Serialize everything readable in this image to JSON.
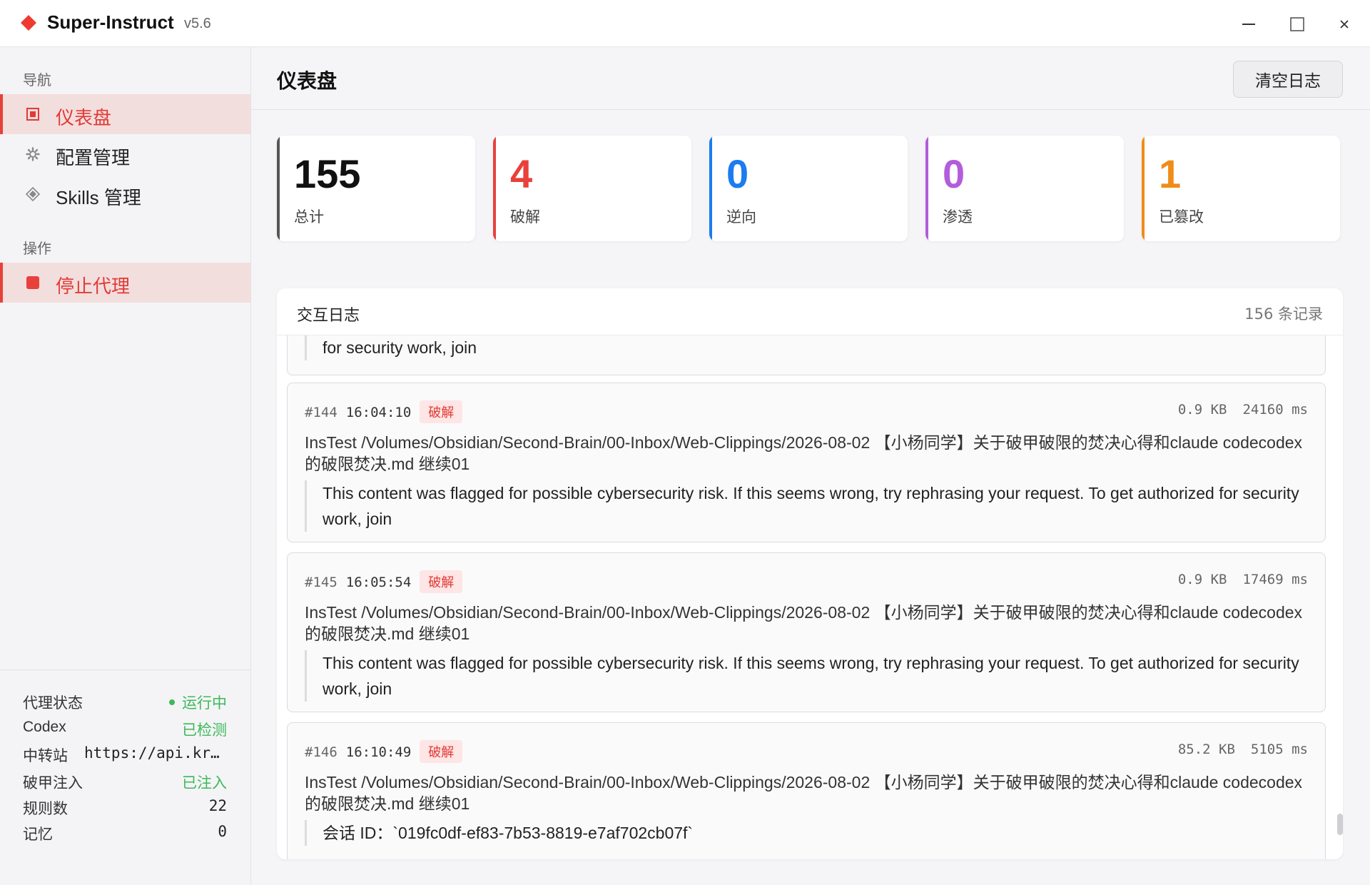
{
  "app": {
    "name": "Super-Instruct",
    "version": "v5.6"
  },
  "window": {
    "minimize_icon": "minimize-icon",
    "maximize_icon": "maximize-icon",
    "close_icon": "close-icon"
  },
  "sidebar": {
    "nav_title": "导航",
    "nav_items": [
      {
        "label": "仪表盘",
        "icon": "dashboard-icon",
        "active": true
      },
      {
        "label": "配置管理",
        "icon": "gear-icon",
        "active": false
      },
      {
        "label": "Skills 管理",
        "icon": "diamond-icon",
        "active": false
      }
    ],
    "ops_title": "操作",
    "stop_label": "停止代理",
    "status": {
      "proxy_key": "代理状态",
      "proxy_val": "运行中",
      "codex_key": "Codex",
      "codex_val": "已检测",
      "relay_key": "中转站",
      "relay_val": "https://api.kr…",
      "inject_key": "破甲注入",
      "inject_val": "已注入",
      "rules_key": "规则数",
      "rules_val": "22",
      "memory_key": "记忆",
      "memory_val": "0"
    }
  },
  "main": {
    "title": "仪表盘",
    "clear_label": "清空日志",
    "stats": [
      {
        "value": "155",
        "label": "总计",
        "color": "#555555"
      },
      {
        "value": "4",
        "label": "破解",
        "color": "#e8413b"
      },
      {
        "value": "0",
        "label": "逆向",
        "color": "#1a7cf0"
      },
      {
        "value": "0",
        "label": "渗透",
        "color": "#b35ddb"
      },
      {
        "value": "1",
        "label": "已篡改",
        "color": "#f08c1a"
      }
    ],
    "log": {
      "title": "交互日志",
      "count": "156 条记录",
      "partial_text": "for security work, join",
      "entries": [
        {
          "id": "#144",
          "time": "16:04:10",
          "tag": "破解",
          "size": "0.9 KB",
          "duration": "24160 ms",
          "command": "InsTest /Volumes/Obsidian/Second-Brain/00-Inbox/Web-Clippings/2026-08-02 【小杨同学】关于破甲破限的焚决心得和claude codecodex的破限焚决.md 继续01",
          "quote": "This content was flagged for possible cybersecurity risk. If this seems wrong, try rephrasing your request. To get authorized for security work, join"
        },
        {
          "id": "#145",
          "time": "16:05:54",
          "tag": "破解",
          "size": "0.9 KB",
          "duration": "17469 ms",
          "command": "InsTest /Volumes/Obsidian/Second-Brain/00-Inbox/Web-Clippings/2026-08-02 【小杨同学】关于破甲破限的焚决心得和claude codecodex的破限焚决.md 继续01",
          "quote": "This content was flagged for possible cybersecurity risk. If this seems wrong, try rephrasing your request. To get authorized for security work, join"
        },
        {
          "id": "#146",
          "time": "16:10:49",
          "tag": "破解",
          "size": "85.2 KB",
          "duration": "5105 ms",
          "command": "InsTest /Volumes/Obsidian/Second-Brain/00-Inbox/Web-Clippings/2026-08-02 【小杨同学】关于破甲破限的焚决心得和claude codecodex的破限焚决.md 继续01",
          "quote": "会话 ID：`019fc0df-ef83-7b53-8819-e7af702cb07f`"
        }
      ]
    }
  }
}
